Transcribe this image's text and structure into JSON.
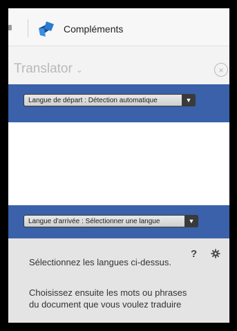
{
  "topbar": {
    "addins_label": "Compléments",
    "brand_colors": [
      "#2b7bd0",
      "#1d4f8f"
    ]
  },
  "panel": {
    "title": "Translator",
    "title_chevron": "⌄",
    "close_glyph": "×"
  },
  "source": {
    "label": "Langue de départ : Détection automatique",
    "arrow": "▼"
  },
  "target": {
    "label": "Langue d'arrivée : Sélectionner une langue",
    "arrow": "▼"
  },
  "help": {
    "help_glyph": "?",
    "instruction_1": "Sélectionnez les langues ci-dessus.",
    "instruction_2": "Choisissez ensuite les mots ou phrases du document que vous voulez traduire"
  },
  "colors": {
    "band": "#3a61a9",
    "panel_bg": "#e4e4e4"
  }
}
